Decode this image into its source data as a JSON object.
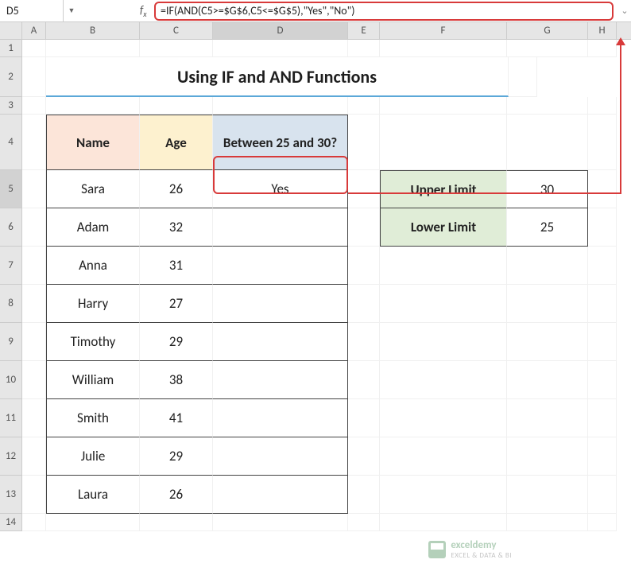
{
  "namebox": "D5",
  "formula": "=IF(AND(C5>=$G$6,C5<=$G$5),\"Yes\",\"No\")",
  "columns": [
    "A",
    "B",
    "C",
    "D",
    "E",
    "F",
    "G",
    "H"
  ],
  "title": "Using IF and AND Functions",
  "headers": {
    "name": "Name",
    "age": "Age",
    "between": "Between 25 and 30?"
  },
  "limits": {
    "upper_label": "Upper Limit",
    "upper_value": "30",
    "lower_label": "Lower Limit",
    "lower_value": "25"
  },
  "rows": [
    {
      "name": "Sara",
      "age": "26",
      "between": "Yes"
    },
    {
      "name": "Adam",
      "age": "32",
      "between": ""
    },
    {
      "name": "Anna",
      "age": "31",
      "between": ""
    },
    {
      "name": "Harry",
      "age": "27",
      "between": ""
    },
    {
      "name": "Timothy",
      "age": "29",
      "between": ""
    },
    {
      "name": "William",
      "age": "38",
      "between": ""
    },
    {
      "name": "Smith",
      "age": "41",
      "between": ""
    },
    {
      "name": "Julie",
      "age": "29",
      "between": ""
    },
    {
      "name": "Laura",
      "age": "26",
      "between": ""
    }
  ],
  "watermark": {
    "brand": "exceldemy",
    "tagline": "EXCEL & DATA & BI"
  }
}
